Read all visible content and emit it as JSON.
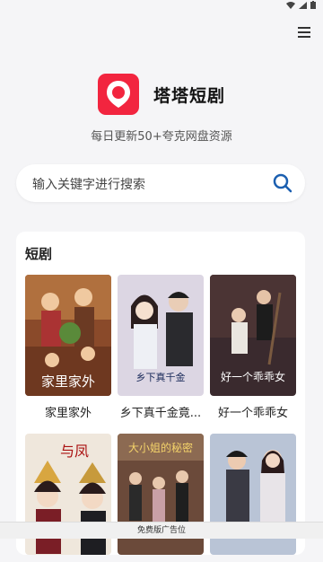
{
  "app": {
    "name": "塔塔短剧",
    "tagline": "每日更新50+夸克网盘资源"
  },
  "search": {
    "placeholder": "输入关键字进行搜索"
  },
  "section": {
    "title": "短剧"
  },
  "posters": [
    {
      "caption": "家里家外",
      "overlay": "家里家外"
    },
    {
      "caption": "乡下真千金竟...",
      "overlay": "乡下真千金"
    },
    {
      "caption": "好一个乖乖女",
      "overlay": "好一个乖乖女"
    },
    {
      "caption": "",
      "overlay": "与凤"
    },
    {
      "caption": "",
      "overlay": "大小姐的秘密"
    },
    {
      "caption": "",
      "overlay": ""
    }
  ],
  "ad": {
    "label": "免费版广告位"
  },
  "colors": {
    "brand": "#f2253f",
    "search_icon": "#1b5fb0"
  }
}
